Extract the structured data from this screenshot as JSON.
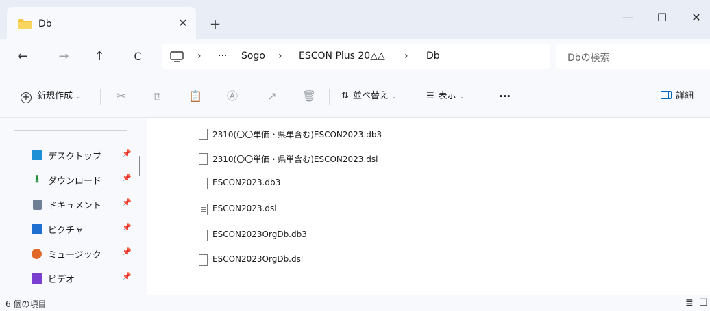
{
  "window": {
    "tab_title": "Db",
    "tab_close": "✕",
    "new_tab": "+",
    "minimize": "—",
    "maximize": "☐",
    "close": "✕"
  },
  "address": {
    "back": "←",
    "forward": "→",
    "up": "↑",
    "refresh": "C",
    "computer_icon": "monitor-icon",
    "sep": "›",
    "more": "···",
    "crumbs": [
      "Sogo",
      "ESCON Plus 20△△",
      "Db"
    ],
    "search_placeholder": "Dbの検索"
  },
  "toolbar": {
    "new_label": "新規作成",
    "sort_label": "並べ替え",
    "view_label": "表示",
    "more_label": "···",
    "details_label": "詳細",
    "chevron": "⌄"
  },
  "nav": {
    "items": [
      {
        "label": "デスクトップ",
        "icon": "desktop-icon",
        "color": "#1e90d6"
      },
      {
        "label": "ダウンロード",
        "icon": "download-icon",
        "color": "#1f8e3a"
      },
      {
        "label": "ドキュメント",
        "icon": "documents-icon",
        "color": "#6f7f95"
      },
      {
        "label": "ピクチャ",
        "icon": "pictures-icon",
        "color": "#1f6fd1"
      },
      {
        "label": "ミュージック",
        "icon": "music-icon",
        "color": "#e2682a"
      },
      {
        "label": "ビデオ",
        "icon": "videos-icon",
        "color": "#7a3fd1"
      }
    ],
    "pin": "📌"
  },
  "files": [
    {
      "name": "2310(〇〇単価・県単含む)ESCON2023.db3",
      "type": "blank"
    },
    {
      "name": "2310(〇〇単価・県単含む)ESCON2023.dsl",
      "type": "doc"
    },
    {
      "name": "ESCON2023.db3",
      "type": "blank"
    },
    {
      "name": "ESCON2023.dsl",
      "type": "doc"
    },
    {
      "name": "ESCON2023OrgDb.db3",
      "type": "blank"
    },
    {
      "name": "ESCON2023OrgDb.dsl",
      "type": "doc"
    }
  ],
  "status": {
    "item_count": "6 個の項目",
    "details_view_icon": "≣",
    "tiles_view_icon": "☐"
  },
  "colors": {
    "folder": "#f4c542",
    "accent": "#0067c0"
  }
}
